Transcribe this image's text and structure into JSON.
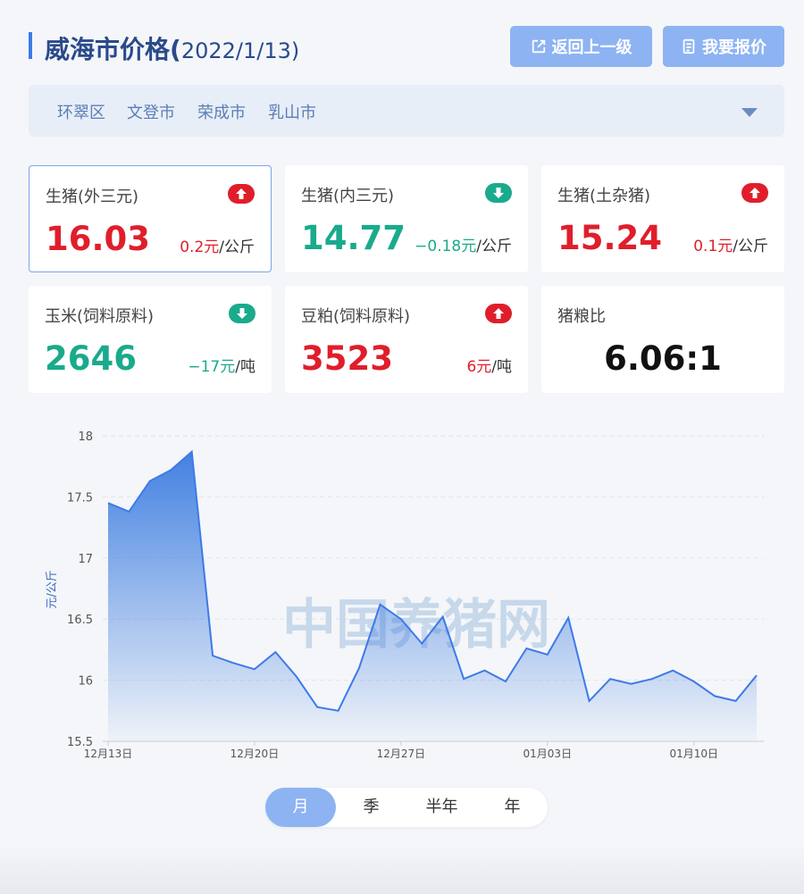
{
  "header": {
    "title": "威海市价格(",
    "date": "2022/1/13)",
    "back_label": "返回上一级",
    "quote_label": "我要报价"
  },
  "districts": [
    "环翠区",
    "文登市",
    "荣成市",
    "乳山市"
  ],
  "cards": [
    {
      "name": "生猪(外三元)",
      "value": "16.03",
      "change": "0.2元",
      "unit": "/公斤",
      "trend": "up"
    },
    {
      "name": "生猪(内三元)",
      "value": "14.77",
      "change": "−0.18元",
      "unit": "/公斤",
      "trend": "down"
    },
    {
      "name": "生猪(土杂猪)",
      "value": "15.24",
      "change": "0.1元",
      "unit": "/公斤",
      "trend": "up"
    },
    {
      "name": "玉米(饲料原料)",
      "value": "2646",
      "change": "−17元",
      "unit": "/吨",
      "trend": "down"
    },
    {
      "name": "豆粕(饲料原料)",
      "value": "3523",
      "change": "6元",
      "unit": "/吨",
      "trend": "up"
    },
    {
      "name": "猪粮比",
      "value": "6.06:1"
    }
  ],
  "colors": {
    "up": "#e01e2b",
    "down": "#1aaa8c",
    "accent": "#3d7ae8",
    "button": "#8db3f3"
  },
  "chart_data": {
    "type": "area",
    "ylabel": "元/公斤",
    "ylim": [
      15.5,
      18
    ],
    "yticks": [
      "18",
      "17.5",
      "17",
      "16.5",
      "16",
      "15.5"
    ],
    "xticks": [
      "12月13日",
      "12月20日",
      "12月27日",
      "01月03日",
      "01月10日"
    ],
    "watermark": "中国养猪网",
    "grid": true,
    "series": [
      {
        "values": [
          17.45,
          17.38,
          17.63,
          17.72,
          17.87,
          16.2,
          16.14,
          16.09,
          16.23,
          16.03,
          15.78,
          15.75,
          16.1,
          16.62,
          16.5,
          16.3,
          16.52,
          16.01,
          16.08,
          15.99,
          16.26,
          16.21,
          16.51,
          15.83,
          16.01,
          15.97,
          16.01,
          16.08,
          15.99,
          15.87,
          15.83,
          16.04
        ]
      }
    ]
  },
  "periods": [
    {
      "label": "月",
      "active": true
    },
    {
      "label": "季",
      "active": false
    },
    {
      "label": "半年",
      "active": false
    },
    {
      "label": "年",
      "active": false
    }
  ]
}
